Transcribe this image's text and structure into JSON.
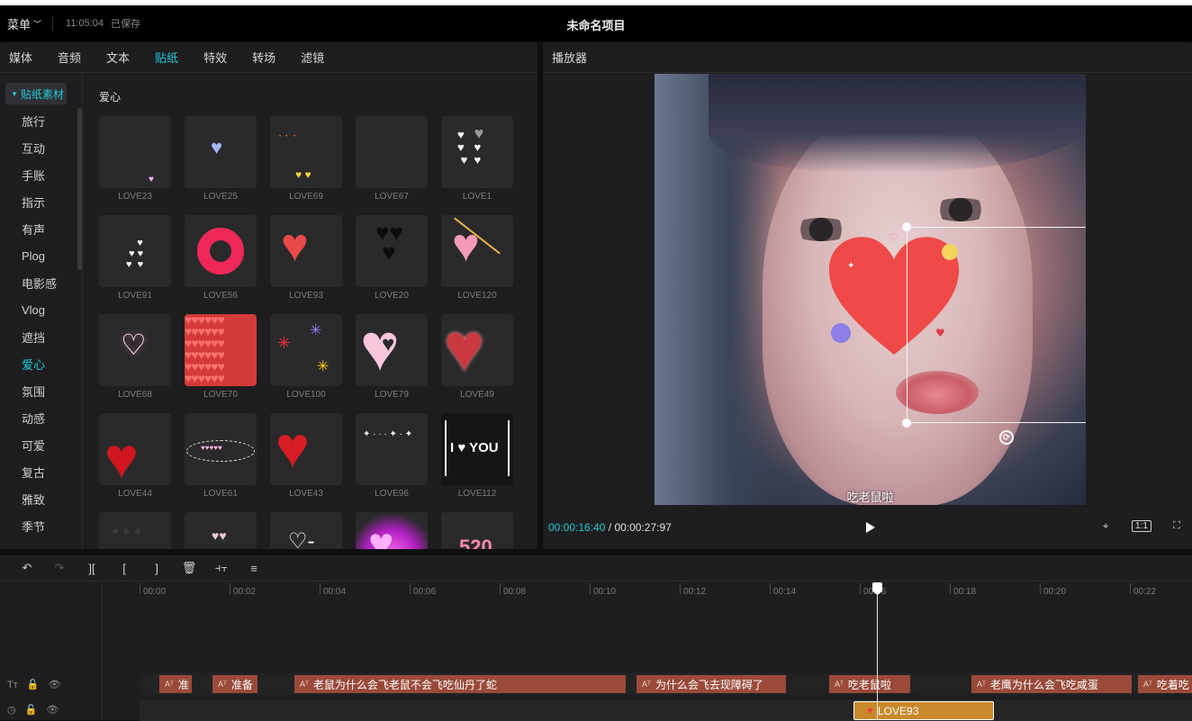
{
  "titlebar": {
    "menu": "菜单",
    "time": "11:05:04",
    "status": "已保存",
    "project": "未命名项目"
  },
  "tabs": [
    "媒体",
    "音频",
    "文本",
    "贴纸",
    "特效",
    "转场",
    "滤镜"
  ],
  "active_tab": "贴纸",
  "sidebar": {
    "header": "贴纸素材",
    "items": [
      "旅行",
      "互动",
      "手账",
      "指示",
      "有声",
      "Plog",
      "电影感",
      "Vlog",
      "遮挡",
      "爱心",
      "氛围",
      "动感",
      "可爱",
      "复古",
      "雅致",
      "季节"
    ],
    "active": "爱心"
  },
  "section_title": "爱心",
  "stickers": [
    "LOVE23",
    "LOVE25",
    "LOVE69",
    "LOVE67",
    "LOVE1",
    "LOVE91",
    "LOVE56",
    "LOVE93",
    "LOVE20",
    "LOVE120",
    "LOVE68",
    "LOVE70",
    "LOVE100",
    "LOVE79",
    "LOVE49",
    "LOVE44",
    "LOVE61",
    "LOVE43",
    "LOVE96",
    "LOVE112",
    "",
    "",
    "",
    "",
    ""
  ],
  "sticker_text": {
    "iyou": "I ♥ YOU",
    "n520": "520"
  },
  "player": {
    "title": "播放器",
    "current": "00:00:16:40",
    "separator": "/",
    "total": "00:00:27:97",
    "subtitle": "吃老鼠啦",
    "ratio": "1:1"
  },
  "timeline": {
    "ruler": [
      "00:00",
      "00:02",
      "00:04",
      "00:06",
      "00:08",
      "00:10",
      "00:12",
      "00:14",
      "00:16",
      "00:18",
      "00:20",
      "00:22"
    ],
    "text_clips": [
      "准",
      "准备",
      "老鼠为什么会飞老鼠不会飞吃仙丹了蛇",
      "为什么会飞去现障碍了",
      "吃老鼠啦",
      "老鹰为什么会飞吃咸蛋",
      "吃着吃"
    ],
    "sticker_clip": "LOVE93",
    "playhead_time": "00:16"
  },
  "colors": {
    "accent": "#22c8d8",
    "text_clip": "#9b4a3a",
    "sticker_clip": "#c9892b"
  }
}
